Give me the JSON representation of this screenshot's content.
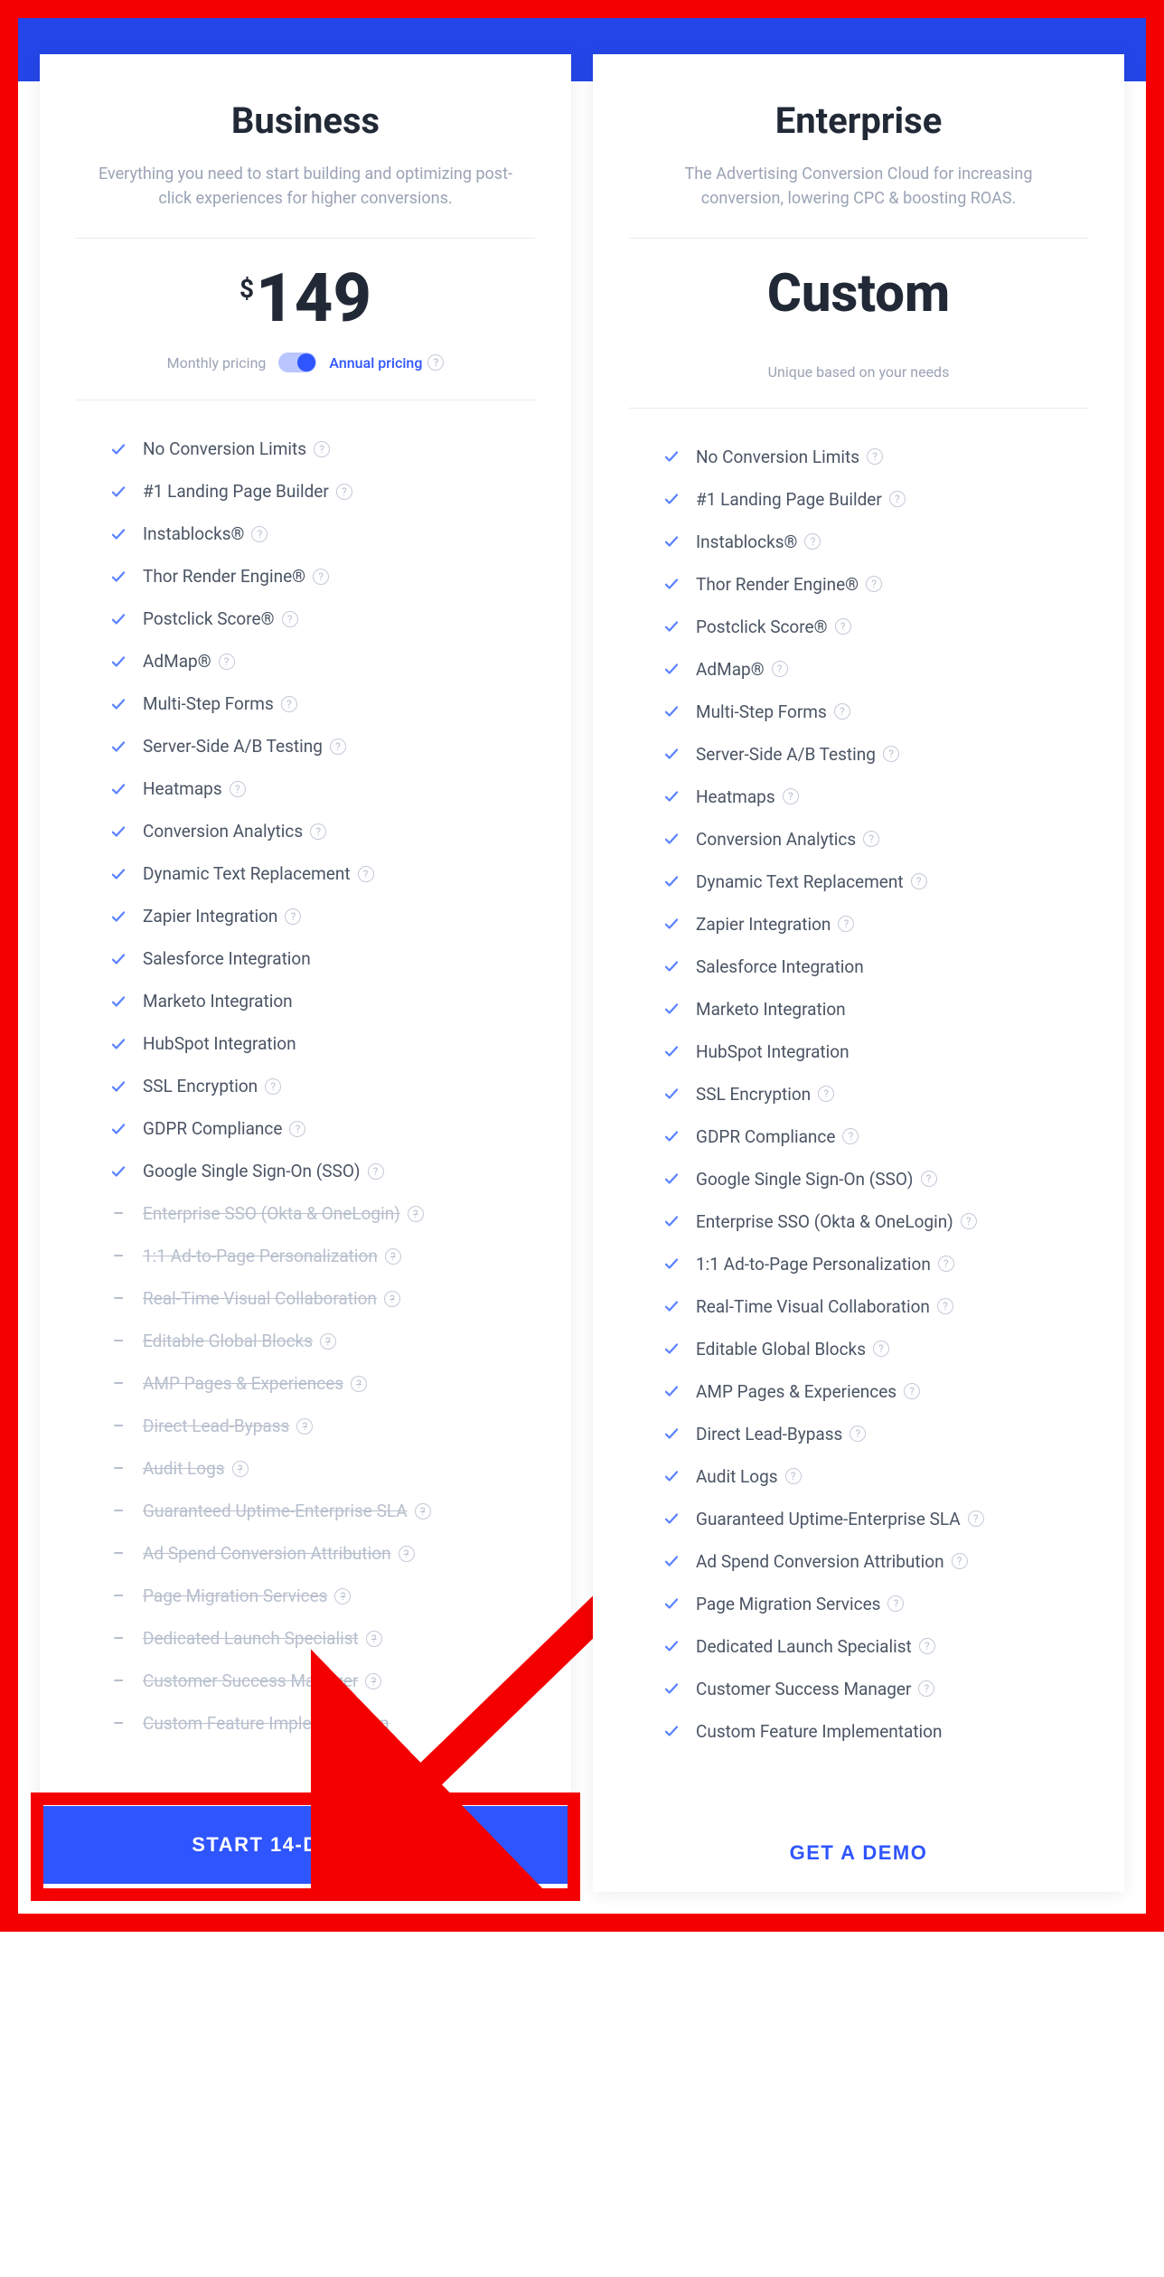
{
  "plans": [
    {
      "name": "Business",
      "subtitle": "Everything you need to start building and optimizing post-click experiences for higher conversions.",
      "price_currency": "$",
      "price_value": "149",
      "toggle": {
        "off": "Monthly pricing",
        "on": "Annual pricing"
      },
      "cta": "START 14-DAY TRIAL",
      "cta_style": "button"
    },
    {
      "name": "Enterprise",
      "subtitle": "The Advertising Conversion Cloud for increasing conversion, lowering CPC & boosting ROAS.",
      "custom_label": "Custom",
      "unique_note": "Unique based on your needs",
      "cta": "GET A DEMO",
      "cta_style": "link"
    }
  ],
  "features": [
    {
      "label": "No Conversion Limits",
      "help": true,
      "biz": true,
      "ent": true
    },
    {
      "label": "#1 Landing Page Builder",
      "help": true,
      "biz": true,
      "ent": true
    },
    {
      "label": "Instablocks®",
      "help": true,
      "biz": true,
      "ent": true
    },
    {
      "label": "Thor Render Engine®",
      "help": true,
      "biz": true,
      "ent": true
    },
    {
      "label": "Postclick Score®",
      "help": true,
      "biz": true,
      "ent": true
    },
    {
      "label": "AdMap®",
      "help": true,
      "biz": true,
      "ent": true
    },
    {
      "label": "Multi-Step Forms",
      "help": true,
      "biz": true,
      "ent": true
    },
    {
      "label": "Server-Side A/B Testing",
      "help": true,
      "biz": true,
      "ent": true
    },
    {
      "label": "Heatmaps",
      "help": true,
      "biz": true,
      "ent": true
    },
    {
      "label": "Conversion Analytics",
      "help": true,
      "biz": true,
      "ent": true
    },
    {
      "label": "Dynamic Text Replacement",
      "help": true,
      "biz": true,
      "ent": true
    },
    {
      "label": "Zapier Integration",
      "help": true,
      "biz": true,
      "ent": true
    },
    {
      "label": "Salesforce Integration",
      "help": false,
      "biz": true,
      "ent": true
    },
    {
      "label": "Marketo Integration",
      "help": false,
      "biz": true,
      "ent": true
    },
    {
      "label": "HubSpot Integration",
      "help": false,
      "biz": true,
      "ent": true
    },
    {
      "label": "SSL Encryption",
      "help": true,
      "biz": true,
      "ent": true
    },
    {
      "label": "GDPR Compliance",
      "help": true,
      "biz": true,
      "ent": true
    },
    {
      "label": "Google Single Sign-On (SSO)",
      "help": true,
      "biz": true,
      "ent": true
    },
    {
      "label": "Enterprise SSO (Okta & OneLogin)",
      "help": true,
      "biz": false,
      "ent": true
    },
    {
      "label": "1:1 Ad-to-Page Personalization",
      "help": true,
      "biz": false,
      "ent": true
    },
    {
      "label": "Real-Time Visual Collaboration",
      "help": true,
      "biz": false,
      "ent": true
    },
    {
      "label": "Editable Global Blocks",
      "help": true,
      "biz": false,
      "ent": true
    },
    {
      "label": "AMP Pages & Experiences",
      "help": true,
      "biz": false,
      "ent": true
    },
    {
      "label": "Direct Lead-Bypass",
      "help": true,
      "biz": false,
      "ent": true
    },
    {
      "label": "Audit Logs",
      "help": true,
      "biz": false,
      "ent": true
    },
    {
      "label": "Guaranteed Uptime-Enterprise SLA",
      "help": true,
      "biz": false,
      "ent": true
    },
    {
      "label": "Ad Spend Conversion Attribution",
      "help": true,
      "biz": false,
      "ent": true
    },
    {
      "label": "Page Migration Services",
      "help": true,
      "biz": false,
      "ent": true
    },
    {
      "label": "Dedicated Launch Specialist",
      "help": true,
      "biz": false,
      "ent": true
    },
    {
      "label": "Customer Success Manager",
      "help": true,
      "biz": false,
      "ent": true
    },
    {
      "label": "Custom Feature Implementation",
      "help": false,
      "biz": false,
      "ent": true
    }
  ],
  "colors": {
    "accent": "#2f55ff",
    "annotation": "#f40000"
  }
}
